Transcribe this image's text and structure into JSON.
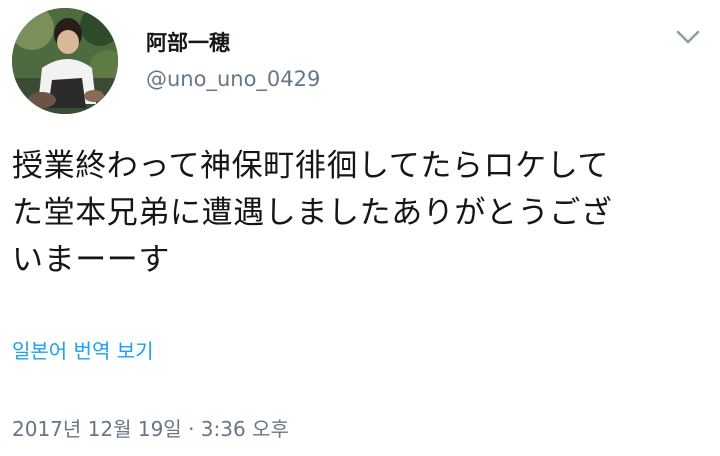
{
  "tweet": {
    "author_name": "阿部一穂",
    "author_handle": "@uno_uno_0429",
    "avatar_icon": "profile-photo",
    "menu_icon": "chevron-down-icon",
    "text": "授業終わって神保町徘徊してたらロケして\nた堂本兄弟に遭遇しましたありがとうござ\nいまーーす",
    "translate_label": "일본어 번역 보기",
    "timestamp": "2017년 12월 19일 · 3:36 오후"
  },
  "colors": {
    "link": "#1da1f2",
    "secondary_text": "#657786",
    "primary_text": "#14171a"
  }
}
